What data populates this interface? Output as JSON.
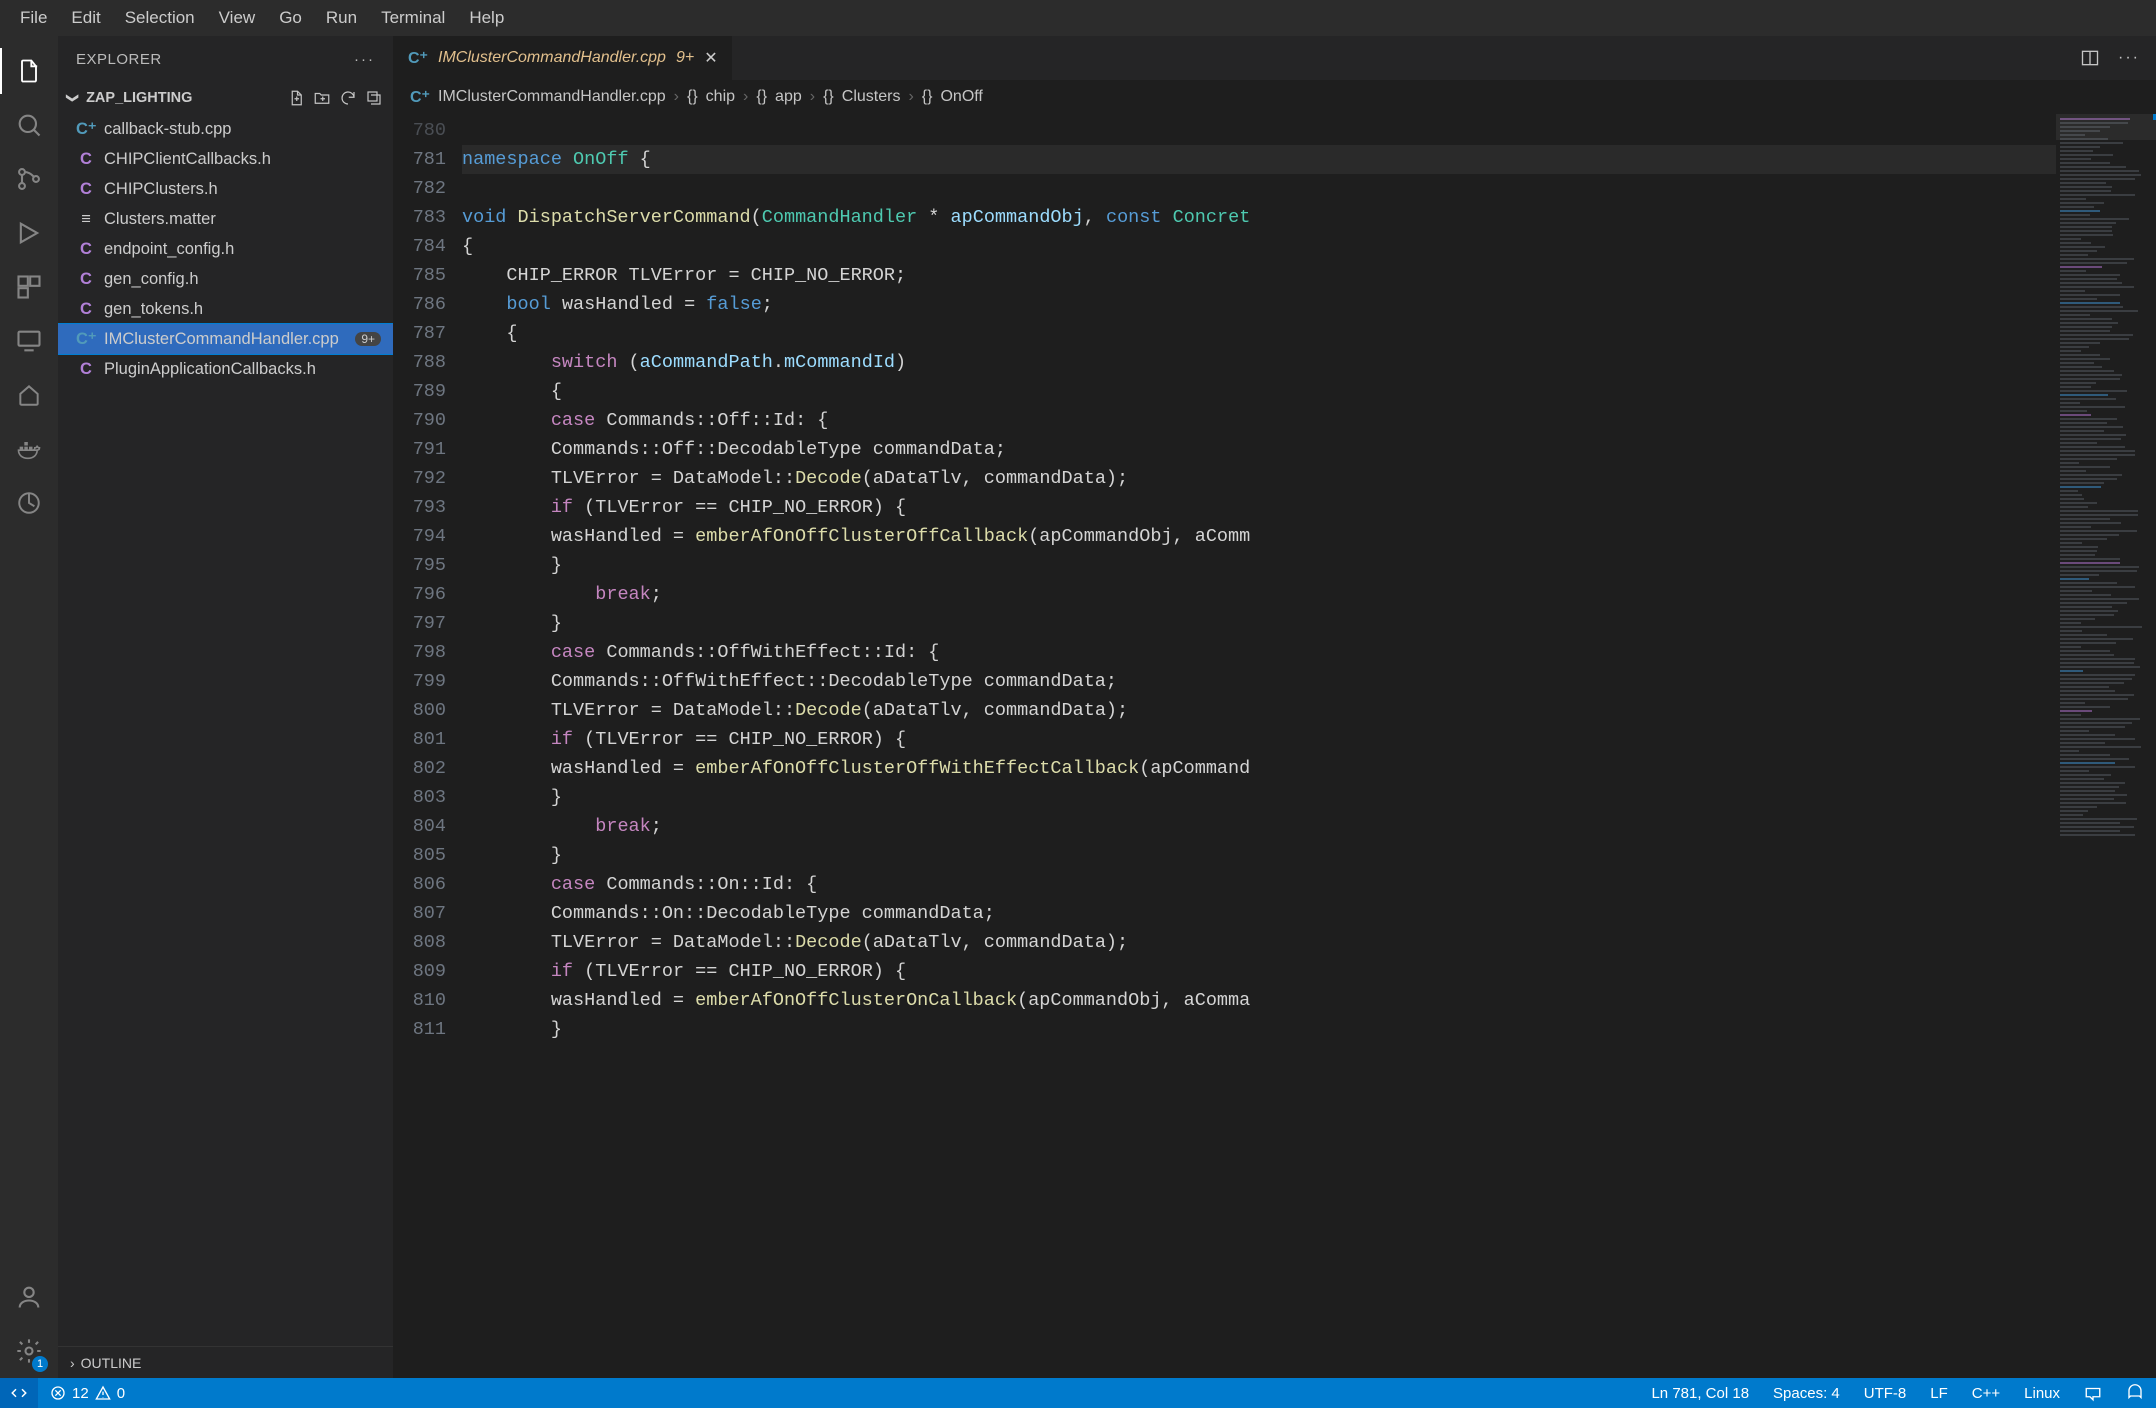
{
  "menubar": [
    "File",
    "Edit",
    "Selection",
    "View",
    "Go",
    "Run",
    "Terminal",
    "Help"
  ],
  "sidebar": {
    "title": "EXPLORER",
    "section": "ZAP_LIGHTING",
    "outline": "OUTLINE",
    "files": [
      {
        "icon": "cpp",
        "iconText": "C⁺",
        "name": "callback-stub.cpp"
      },
      {
        "icon": "ch",
        "iconText": "C",
        "name": "CHIPClientCallbacks.h"
      },
      {
        "icon": "ch",
        "iconText": "C",
        "name": "CHIPClusters.h"
      },
      {
        "icon": "txt",
        "iconText": "≡",
        "name": "Clusters.matter"
      },
      {
        "icon": "ch",
        "iconText": "C",
        "name": "endpoint_config.h"
      },
      {
        "icon": "ch",
        "iconText": "C",
        "name": "gen_config.h"
      },
      {
        "icon": "ch",
        "iconText": "C",
        "name": "gen_tokens.h"
      },
      {
        "icon": "cpp",
        "iconText": "C⁺",
        "name": "IMClusterCommandHandler.cpp",
        "selected": true,
        "badge": "9+"
      },
      {
        "icon": "ch",
        "iconText": "C",
        "name": "PluginApplicationCallbacks.h"
      }
    ]
  },
  "tab": {
    "iconText": "C⁺",
    "name": "IMClusterCommandHandler.cpp",
    "badge": "9+"
  },
  "breadcrumb": [
    {
      "icon": "C⁺",
      "label": "IMClusterCommandHandler.cpp"
    },
    {
      "icon": "{}",
      "label": "chip"
    },
    {
      "icon": "{}",
      "label": "app"
    },
    {
      "icon": "{}",
      "label": "Clusters"
    },
    {
      "icon": "{}",
      "label": "OnOff"
    }
  ],
  "code": {
    "startLine": 780,
    "lines": [
      {
        "n": 780,
        "dim": true,
        "seg": []
      },
      {
        "n": 781,
        "hl": true,
        "seg": [
          {
            "t": "namespace ",
            "c": "kw"
          },
          {
            "t": "OnOff",
            "c": "ty"
          },
          {
            "t": " {",
            "c": "op"
          }
        ]
      },
      {
        "n": 782,
        "seg": []
      },
      {
        "n": 783,
        "seg": [
          {
            "t": "void ",
            "c": "kw"
          },
          {
            "t": "DispatchServerCommand",
            "c": "fn"
          },
          {
            "t": "(",
            "c": "op"
          },
          {
            "t": "CommandHandler",
            "c": "ty"
          },
          {
            "t": " * ",
            "c": "op"
          },
          {
            "t": "apCommandObj",
            "c": "va"
          },
          {
            "t": ", ",
            "c": "op"
          },
          {
            "t": "const ",
            "c": "kw"
          },
          {
            "t": "Concret",
            "c": "ty"
          }
        ]
      },
      {
        "n": 784,
        "seg": [
          {
            "t": "{",
            "c": "op"
          }
        ]
      },
      {
        "n": 785,
        "seg": [
          {
            "t": "    CHIP_ERROR TLVError = CHIP_NO_ERROR;",
            "c": "op"
          }
        ]
      },
      {
        "n": 786,
        "seg": [
          {
            "t": "    ",
            "c": "op"
          },
          {
            "t": "bool",
            "c": "kw"
          },
          {
            "t": " wasHandled = ",
            "c": "op"
          },
          {
            "t": "false",
            "c": "kw"
          },
          {
            "t": ";",
            "c": "op"
          }
        ]
      },
      {
        "n": 787,
        "seg": [
          {
            "t": "    {",
            "c": "op"
          }
        ]
      },
      {
        "n": 788,
        "seg": [
          {
            "t": "        ",
            "c": "op"
          },
          {
            "t": "switch",
            "c": "ctl"
          },
          {
            "t": " (",
            "c": "op"
          },
          {
            "t": "aCommandPath",
            "c": "va"
          },
          {
            "t": ".",
            "c": "op"
          },
          {
            "t": "mCommandId",
            "c": "va"
          },
          {
            "t": ")",
            "c": "op"
          }
        ]
      },
      {
        "n": 789,
        "seg": [
          {
            "t": "        {",
            "c": "op"
          }
        ]
      },
      {
        "n": 790,
        "seg": [
          {
            "t": "        ",
            "c": "op"
          },
          {
            "t": "case",
            "c": "ctl"
          },
          {
            "t": " Commands::Off::Id: {",
            "c": "op"
          }
        ]
      },
      {
        "n": 791,
        "seg": [
          {
            "t": "        Commands::Off::DecodableType commandData;",
            "c": "op"
          }
        ]
      },
      {
        "n": 792,
        "seg": [
          {
            "t": "        TLVError = DataModel::",
            "c": "op"
          },
          {
            "t": "Decode",
            "c": "fn"
          },
          {
            "t": "(aDataTlv, commandData);",
            "c": "op"
          }
        ]
      },
      {
        "n": 793,
        "seg": [
          {
            "t": "        ",
            "c": "op"
          },
          {
            "t": "if",
            "c": "ctl"
          },
          {
            "t": " (TLVError == CHIP_NO_ERROR) {",
            "c": "op"
          }
        ]
      },
      {
        "n": 794,
        "seg": [
          {
            "t": "        wasHandled = ",
            "c": "op"
          },
          {
            "t": "emberAfOnOffClusterOffCallback",
            "c": "fn"
          },
          {
            "t": "(apCommandObj, aComm",
            "c": "op"
          }
        ]
      },
      {
        "n": 795,
        "seg": [
          {
            "t": "        }",
            "c": "op"
          }
        ]
      },
      {
        "n": 796,
        "seg": [
          {
            "t": "            ",
            "c": "op"
          },
          {
            "t": "break",
            "c": "ctl"
          },
          {
            "t": ";",
            "c": "op"
          }
        ]
      },
      {
        "n": 797,
        "seg": [
          {
            "t": "        }",
            "c": "op"
          }
        ]
      },
      {
        "n": 798,
        "seg": [
          {
            "t": "        ",
            "c": "op"
          },
          {
            "t": "case",
            "c": "ctl"
          },
          {
            "t": " Commands::OffWithEffect::Id: {",
            "c": "op"
          }
        ]
      },
      {
        "n": 799,
        "seg": [
          {
            "t": "        Commands::OffWithEffect::DecodableType commandData;",
            "c": "op"
          }
        ]
      },
      {
        "n": 800,
        "seg": [
          {
            "t": "        TLVError = DataModel::",
            "c": "op"
          },
          {
            "t": "Decode",
            "c": "fn"
          },
          {
            "t": "(aDataTlv, commandData);",
            "c": "op"
          }
        ]
      },
      {
        "n": 801,
        "seg": [
          {
            "t": "        ",
            "c": "op"
          },
          {
            "t": "if",
            "c": "ctl"
          },
          {
            "t": " (TLVError == CHIP_NO_ERROR) {",
            "c": "op"
          }
        ]
      },
      {
        "n": 802,
        "seg": [
          {
            "t": "        wasHandled = ",
            "c": "op"
          },
          {
            "t": "emberAfOnOffClusterOffWithEffectCallback",
            "c": "fn"
          },
          {
            "t": "(apCommand",
            "c": "op"
          }
        ]
      },
      {
        "n": 803,
        "seg": [
          {
            "t": "        }",
            "c": "op"
          }
        ]
      },
      {
        "n": 804,
        "seg": [
          {
            "t": "            ",
            "c": "op"
          },
          {
            "t": "break",
            "c": "ctl"
          },
          {
            "t": ";",
            "c": "op"
          }
        ]
      },
      {
        "n": 805,
        "seg": [
          {
            "t": "        }",
            "c": "op"
          }
        ]
      },
      {
        "n": 806,
        "seg": [
          {
            "t": "        ",
            "c": "op"
          },
          {
            "t": "case",
            "c": "ctl"
          },
          {
            "t": " Commands::On::Id: {",
            "c": "op"
          }
        ]
      },
      {
        "n": 807,
        "seg": [
          {
            "t": "        Commands::On::DecodableType commandData;",
            "c": "op"
          }
        ]
      },
      {
        "n": 808,
        "seg": [
          {
            "t": "        TLVError = DataModel::",
            "c": "op"
          },
          {
            "t": "Decode",
            "c": "fn"
          },
          {
            "t": "(aDataTlv, commandData);",
            "c": "op"
          }
        ]
      },
      {
        "n": 809,
        "seg": [
          {
            "t": "        ",
            "c": "op"
          },
          {
            "t": "if",
            "c": "ctl"
          },
          {
            "t": " (TLVError == CHIP_NO_ERROR) {",
            "c": "op"
          }
        ]
      },
      {
        "n": 810,
        "seg": [
          {
            "t": "        wasHandled = ",
            "c": "op"
          },
          {
            "t": "emberAfOnOffClusterOnCallback",
            "c": "fn"
          },
          {
            "t": "(apCommandObj, aComma",
            "c": "op"
          }
        ]
      },
      {
        "n": 811,
        "seg": [
          {
            "t": "        }",
            "c": "op"
          }
        ]
      }
    ]
  },
  "status": {
    "errors": "12",
    "warnings": "0",
    "cursor": "Ln 781, Col 18",
    "spaces": "Spaces: 4",
    "encoding": "UTF-8",
    "eol": "LF",
    "lang": "C++",
    "os": "Linux"
  }
}
